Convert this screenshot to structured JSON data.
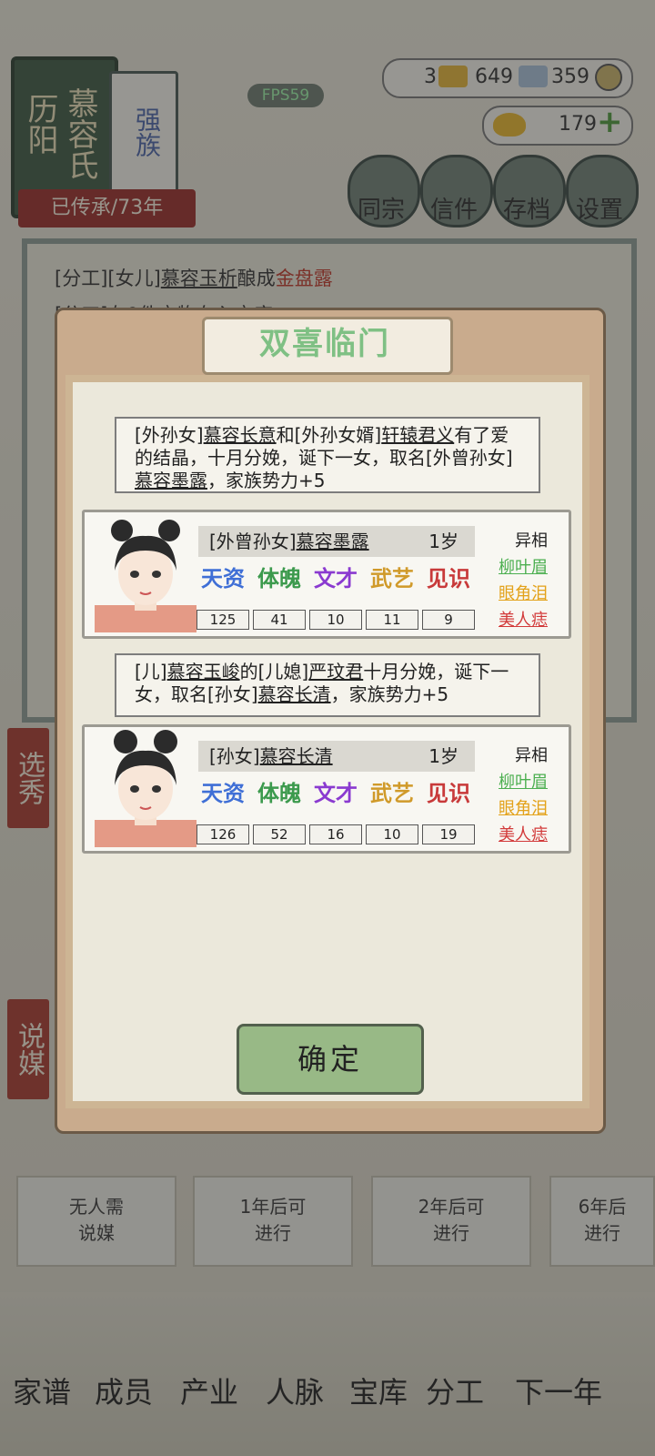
{
  "fps": "FPS59",
  "family": {
    "place": "历阳",
    "surname": "慕容氏",
    "rank": "强族",
    "inherit": "已传承/73年"
  },
  "resources": {
    "a": "3",
    "b": "649",
    "c": "359",
    "ingot": "179",
    "plus": "+"
  },
  "top_menu": [
    "同宗",
    "信件",
    "存档",
    "设置"
  ],
  "log": {
    "line1_prefix": "[分工][女儿]",
    "line1_name": "慕容玉析",
    "line1_mid": "酿成",
    "line1_item": "金盘露",
    "line2": "[分工]有9件宝物存入宝库"
  },
  "side_tabs": [
    "选秀",
    "说媒"
  ],
  "bottom_cards": [
    {
      "line1": "无人需",
      "line2": "说媒"
    },
    {
      "line1": "1年后可",
      "line2": "进行"
    },
    {
      "line1": "2年后可",
      "line2": "进行"
    },
    {
      "line1": "6年后",
      "line2": "进行"
    }
  ],
  "bottom_nav": [
    "家谱",
    "成员",
    "产业",
    "人脉",
    "宝库",
    "分工",
    "下一年"
  ],
  "dialog": {
    "title": "双喜临门",
    "confirm": "确定",
    "msg1": {
      "p1": "[外孙女]",
      "n1": "慕容长意",
      "p2": "和[外孙女婿]",
      "n2": "轩辕君义",
      "p3": "有了爱的结晶，十月分娩，诞下一女，取名[外曾孙女]",
      "n3": "慕容墨露",
      "p4": "，家族势力+5"
    },
    "child1": {
      "title": "[外曾孙女]",
      "name": "慕容墨露",
      "age": "1岁",
      "stats": {
        "tianzi": "125",
        "tipo": "41",
        "wencai": "10",
        "wuyi": "11",
        "jianshi": "9"
      },
      "traits_title": "异相",
      "traits": [
        "柳叶眉",
        "眼角泪",
        "美人痣"
      ]
    },
    "msg2": {
      "p1": "[儿]",
      "n1": "慕容玉峻",
      "p2": "的[儿媳]",
      "n2": "严玟君",
      "p3": "十月分娩，诞下一女，取名[孙女]",
      "n3": "慕容长清",
      "p4": "，家族势力+5"
    },
    "child2": {
      "title": "[孙女]",
      "name": "慕容长清",
      "age": "1岁",
      "stats": {
        "tianzi": "126",
        "tipo": "52",
        "wencai": "16",
        "wuyi": "10",
        "jianshi": "19"
      },
      "traits_title": "异相",
      "traits": [
        "柳叶眉",
        "眼角泪",
        "美人痣"
      ]
    },
    "stat_labels": {
      "tianzi": "天资",
      "tipo": "体魄",
      "wencai": "文才",
      "wuyi": "武艺",
      "jianshi": "见识"
    }
  },
  "colors": {
    "tianzi": "#3f6fd6",
    "tipo": "#3c9a4d",
    "wencai": "#8a3ad0",
    "wuyi": "#d09a2a",
    "jianshi": "#c83a3a",
    "trait1": "#4caf50",
    "trait2": "#e3a21a",
    "trait3": "#d23a3a"
  }
}
